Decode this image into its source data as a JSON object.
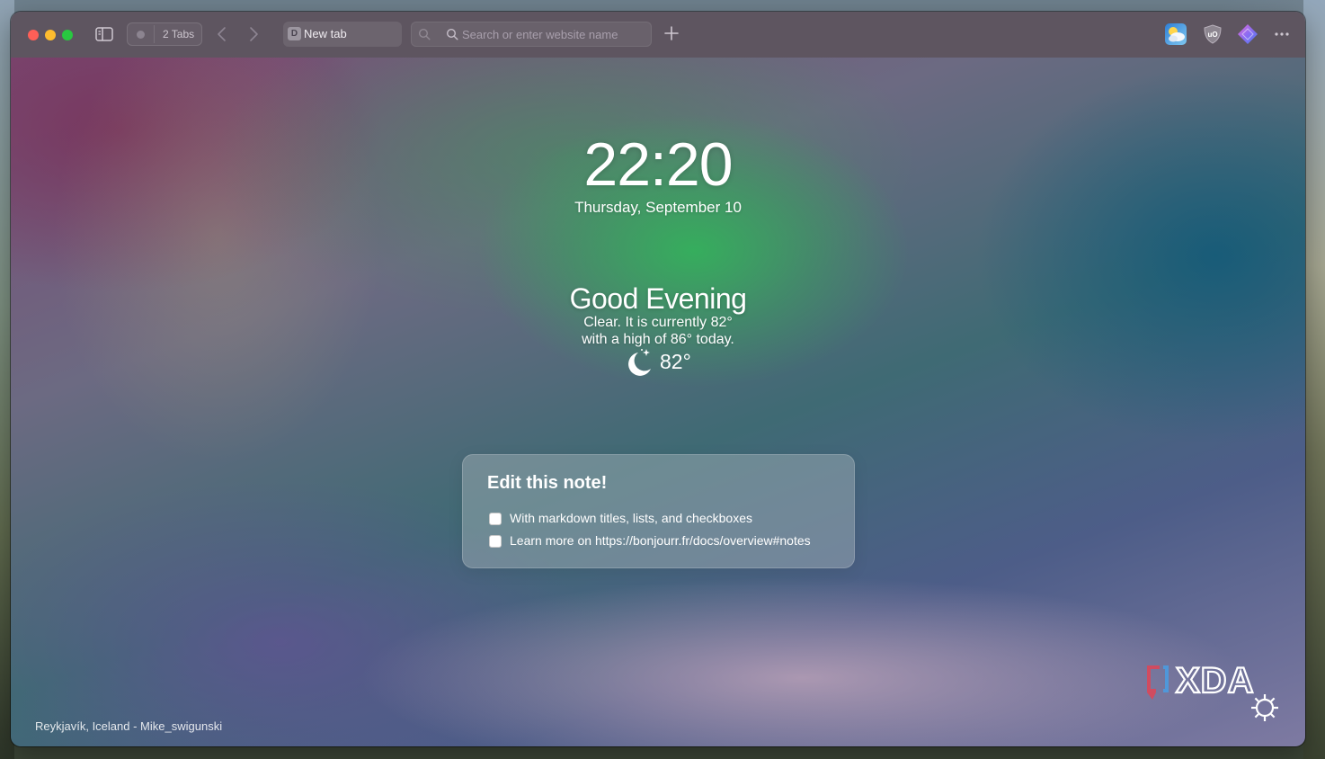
{
  "browser": {
    "tab_group_label": "2 Tabs",
    "active_tab": {
      "favicon_letter": "D",
      "title": "New tab"
    },
    "address_bar": {
      "placeholder": "Search or enter website name",
      "value": ""
    },
    "icons": {
      "sidebar": "sidebar-icon",
      "back": "chevron-left-icon",
      "forward": "chevron-right-icon",
      "search": "magnifier-icon",
      "new_tab": "plus-icon",
      "more": "ellipsis-icon"
    },
    "extensions": [
      "weather-extension-icon",
      "ublock-origin-icon",
      "gem-extension-icon"
    ]
  },
  "bonjourr": {
    "time": "22:20",
    "date": "Thursday, September 10",
    "greeting": "Good Evening",
    "weather": {
      "description_line1": "Clear. It is currently 82°",
      "description_line2": "with a high of 86° today.",
      "icon": "clear-night-moon-icon",
      "temperature": "82°"
    },
    "note": {
      "title": "Edit this note!",
      "items": [
        {
          "text": "With markdown titles, lists, and checkboxes",
          "checked": false
        },
        {
          "text": "Learn more on https://bonjourr.fr/docs/overview#notes",
          "checked": false
        }
      ]
    },
    "photo_credit": "Reykjavík, Iceland - Mike_swigunski",
    "watermark": "XDA",
    "settings_icon": "gear-icon"
  },
  "colors": {
    "traffic_close": "#fe5f57",
    "traffic_minimize": "#febc2e",
    "traffic_maximize": "#28c840",
    "toolbar": "#5e5560"
  }
}
